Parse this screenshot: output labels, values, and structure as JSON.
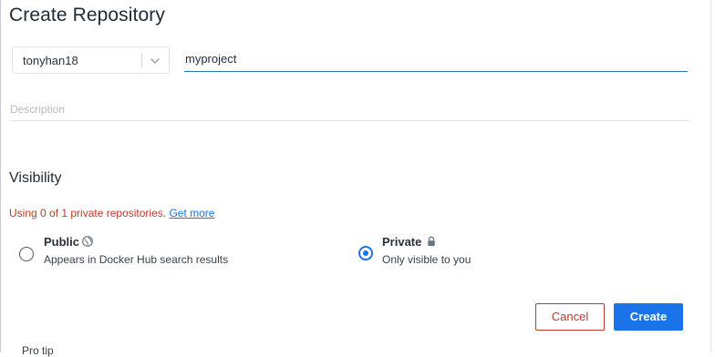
{
  "page": {
    "title": "Create Repository"
  },
  "namespace": {
    "value": "tonyhan18"
  },
  "repo_name": {
    "value": "myproject"
  },
  "description": {
    "placeholder": "Description"
  },
  "visibility": {
    "heading": "Visibility",
    "usage_text": "Using 0 of 1 private repositories.",
    "usage_link": "Get more",
    "usage_color": "#c0392b",
    "options": [
      {
        "label": "Public",
        "description": "Appears in Docker Hub search results",
        "icon": "globe-icon",
        "selected": false
      },
      {
        "label": "Private",
        "description": "Only visible to you",
        "icon": "lock-icon",
        "selected": true
      }
    ]
  },
  "actions": {
    "cancel_label": "Cancel",
    "create_label": "Create",
    "accent_color": "#1a73e8",
    "cancel_color": "#c0392b"
  },
  "footer": {
    "tip_partial": "Pro tip"
  }
}
